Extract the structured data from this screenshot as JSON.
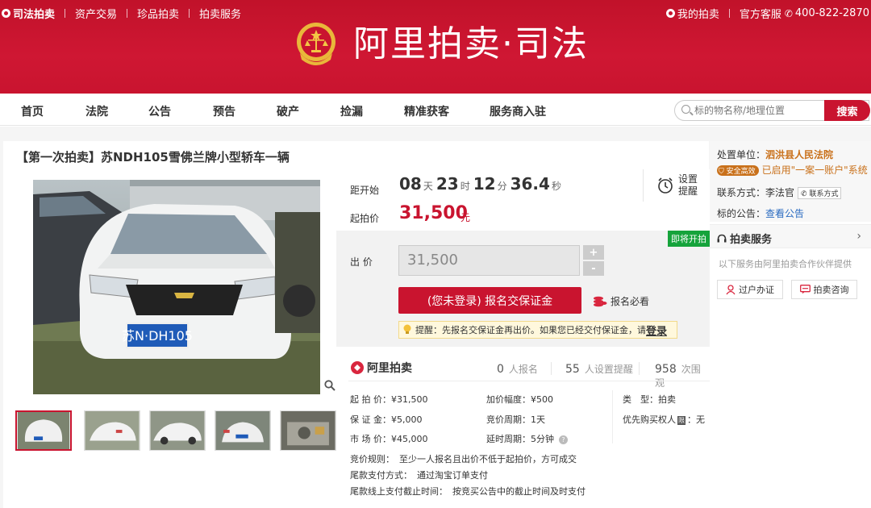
{
  "topbar": {
    "brand": "司法拍卖",
    "links": [
      "资产交易",
      "珍品拍卖",
      "拍卖服务"
    ],
    "my_auction": "我的拍卖",
    "service": "官方客服",
    "phone": "400-822-2870"
  },
  "logo": {
    "title": "阿里拍卖·司法"
  },
  "nav": {
    "items": [
      "首页",
      "法院",
      "公告",
      "预告",
      "破产",
      "捡漏",
      "精准获客",
      "服务商入驻"
    ],
    "search_placeholder": "标的物名称/地理位置",
    "search_button": "搜索"
  },
  "item": {
    "title": "【第一次拍卖】苏NDH105雪佛兰牌小型轿车一辆",
    "plate": "苏N·DH105"
  },
  "countdown": {
    "label": "距开始",
    "days": "08",
    "days_unit": "天",
    "hours": "23",
    "hours_unit": "时",
    "minutes": "12",
    "minutes_unit": "分",
    "seconds": "36.4",
    "seconds_unit": "秒"
  },
  "reminder": {
    "line1": "设置",
    "line2": "提醒"
  },
  "start_price": {
    "label": "起拍价",
    "value": "31,500",
    "unit": "元"
  },
  "bid": {
    "status_tag": "即将开拍",
    "label": "出 价",
    "input_value": "31,500",
    "plus": "+",
    "minus": "-",
    "deposit_button": "(您未登录) 报名交保证金",
    "must_read": "报名必看",
    "hint": "提醒：先报名交保证金再出价。如果您已经交付保证金，请",
    "hint_login": "登录"
  },
  "stats": {
    "brand": "阿里拍卖",
    "signup_count": "0",
    "signup_label": "人报名",
    "reminder_count": "55",
    "reminder_label": "人设置提醒",
    "view_count": "958",
    "view_label": "次围观"
  },
  "details": {
    "start_price": {
      "k": "起 拍 价：",
      "v": "¥31,500"
    },
    "deposit": {
      "k": "保 证 金：",
      "v": "¥5,000"
    },
    "market_price": {
      "k": "市 场 价：",
      "v": "¥45,000"
    },
    "increment": {
      "k": "加价幅度：",
      "v": "¥500"
    },
    "cycle": {
      "k": "竞价周期：",
      "v": "1天"
    },
    "delay": {
      "k": "延时周期：",
      "v": "5分钟"
    },
    "type": {
      "k": "类　型：",
      "v": "拍卖"
    },
    "priority": {
      "k": "优先购买权人",
      "badge": "限",
      "v": "：无"
    }
  },
  "rules": [
    {
      "k": "竞价规则：",
      "v": "至少一人报名且出价不低于起拍价，方可成交"
    },
    {
      "k": "尾款支付方式：",
      "v": "通过淘宝订单支付"
    },
    {
      "k": "尾款线上支付截止时间：",
      "v": "按竞买公告中的截止时间及时支付"
    }
  ],
  "sidebar": {
    "court_label": "处置单位：",
    "court": "泗洪县人民法院",
    "safe_badge": "安全高效",
    "safe_text": "已启用\"一案一账户\"系统",
    "contact_label": "联系方式：",
    "contact_name": "李法官",
    "contact_btn": "联系方式",
    "notice_label": "标的公告：",
    "notice_link": "查看公告",
    "service_title": "拍卖服务",
    "service_desc": "以下服务由阿里拍卖合作伙伴提供",
    "btn_transfer": "过户办证",
    "btn_consult": "拍卖咨询"
  },
  "colors": {
    "brand_red": "#c9142f",
    "start_green": "#15a33b",
    "link_blue": "#2a6bc0"
  }
}
